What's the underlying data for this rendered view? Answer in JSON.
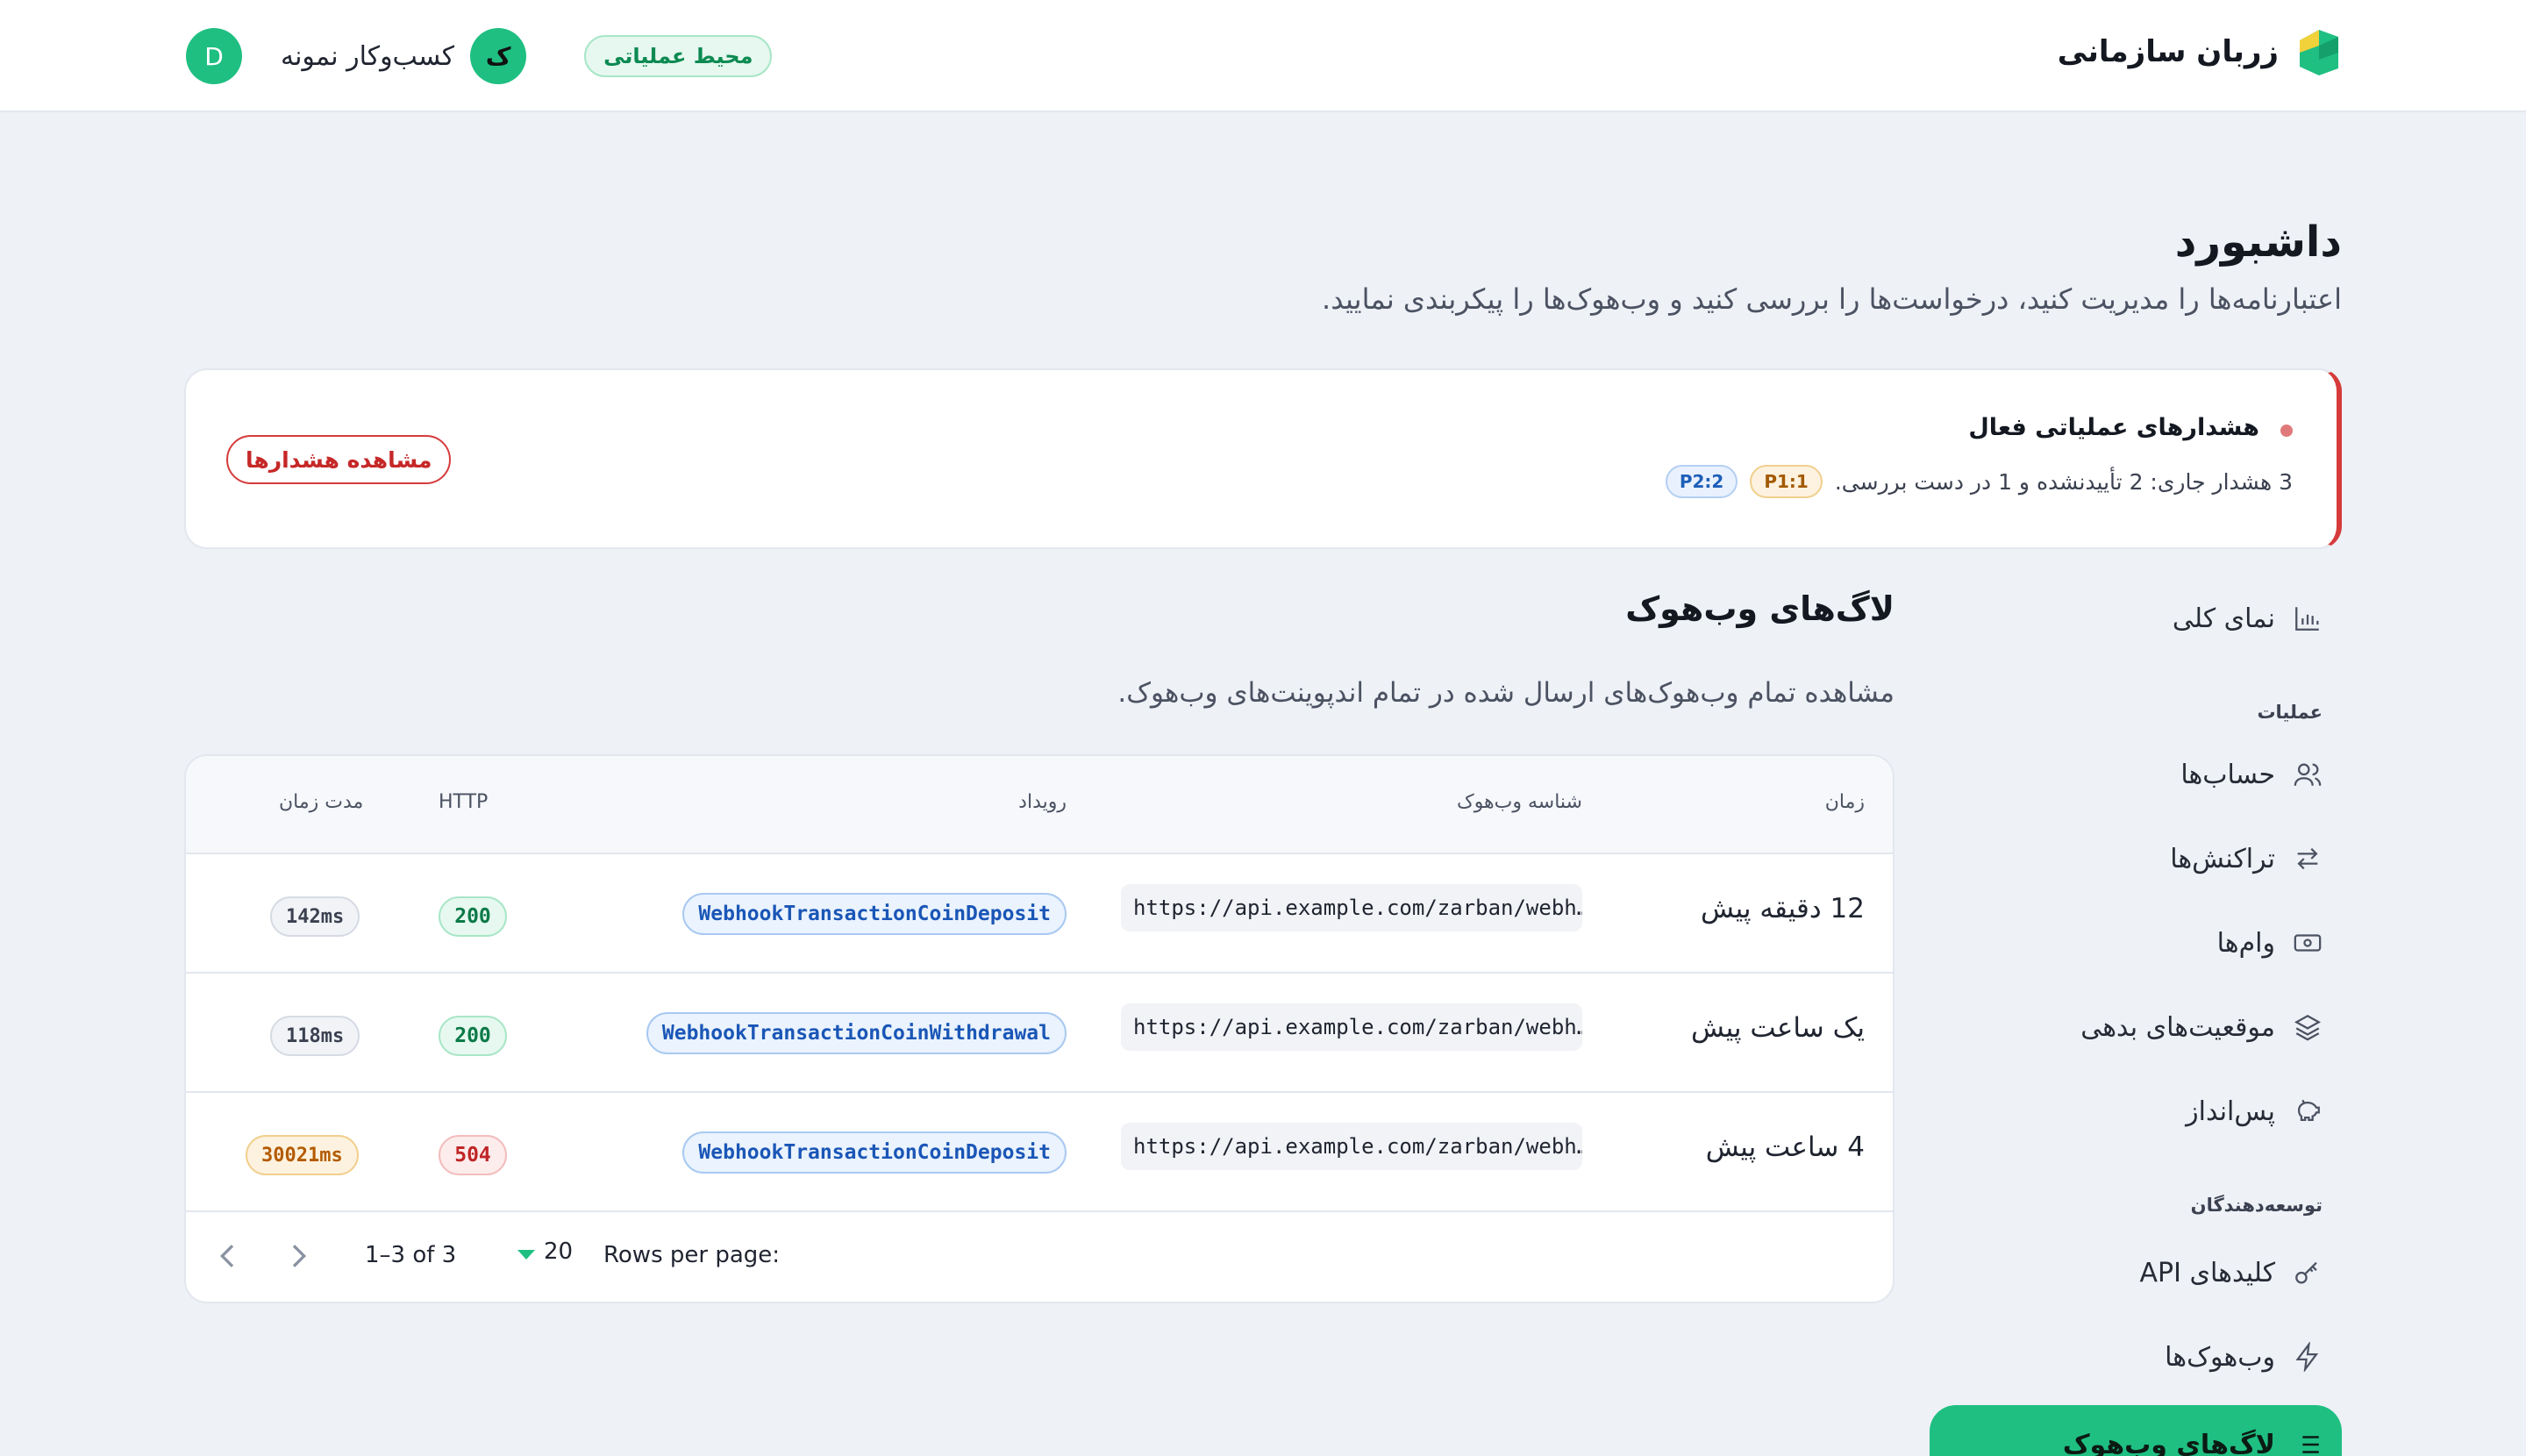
{
  "header": {
    "brand_name": "زربان سازمانی",
    "env_badge": "محیط عملیاتی",
    "business_name": "کسب‌وکار نمونه",
    "business_avatar": "ک",
    "user_avatar": "D"
  },
  "page": {
    "title": "داشبورد",
    "subtitle": "اعتبارنامه‌ها را مدیریت کنید، درخواست‌ها را بررسی کنید و وب‌هوک‌ها را پیکربندی نمایید."
  },
  "alert": {
    "title": "هشدارهای عملیاتی فعال",
    "description": "3 هشدار جاری: 2 تأییدنشده و 1 در دست بررسی.",
    "p1": "P1:1",
    "p2": "P2:2",
    "button": "مشاهده هشدارها",
    "accent": "#d63b3b"
  },
  "sidebar": {
    "overview": {
      "label": "نمای کلی",
      "icon": "bar-chart-icon"
    },
    "section_ops": "عملیات",
    "accounts": {
      "label": "حساب‌ها",
      "icon": "users-icon"
    },
    "transactions": {
      "label": "تراکنش‌ها",
      "icon": "arrows-swap-icon"
    },
    "loans": {
      "label": "وام‌ها",
      "icon": "banknote-icon"
    },
    "debt": {
      "label": "موقعیت‌های بدهی",
      "icon": "layers-icon"
    },
    "savings": {
      "label": "پس‌انداز",
      "icon": "piggy-bank-icon"
    },
    "section_dev": "توسعه‌دهندگان",
    "api_keys": {
      "label": "کلیدهای API",
      "icon": "key-icon"
    },
    "webhooks": {
      "label": "وب‌هوک‌ها",
      "icon": "lightning-icon"
    },
    "webhook_logs": {
      "label": "لاگ‌های وب‌هوک",
      "icon": "list-icon"
    },
    "accent": "#1fbf82"
  },
  "main": {
    "title": "لاگ‌های وب‌هوک",
    "subtitle": "مشاهده تمام وب‌هوک‌های ارسال شده در تمام اندپوینت‌های وب‌هوک."
  },
  "table": {
    "headers": {
      "time": "زمان",
      "webhook_id": "شناسه وب‌هوک",
      "event": "رویداد",
      "http": "HTTP",
      "duration": "مدت زمان"
    },
    "rows": [
      {
        "time": "12 دقیقه پیش",
        "url": "https://api.example.com/zarban/webh…",
        "event": "WebhookTransactionCoinDeposit",
        "http": "200",
        "duration": "142ms"
      },
      {
        "time": "یک ساعت پیش",
        "url": "https://api.example.com/zarban/webh…",
        "event": "WebhookTransactionCoinWithdrawal",
        "http": "200",
        "duration": "118ms"
      },
      {
        "time": "4 ساعت پیش",
        "url": "https://api.example.com/zarban/webh…",
        "event": "WebhookTransactionCoinDeposit",
        "http": "504",
        "duration": "30021ms"
      }
    ]
  },
  "pagination": {
    "rows_per_page_label": "Rows per page:",
    "rows_per_page_value": "20",
    "range": "1–3 of 3"
  }
}
